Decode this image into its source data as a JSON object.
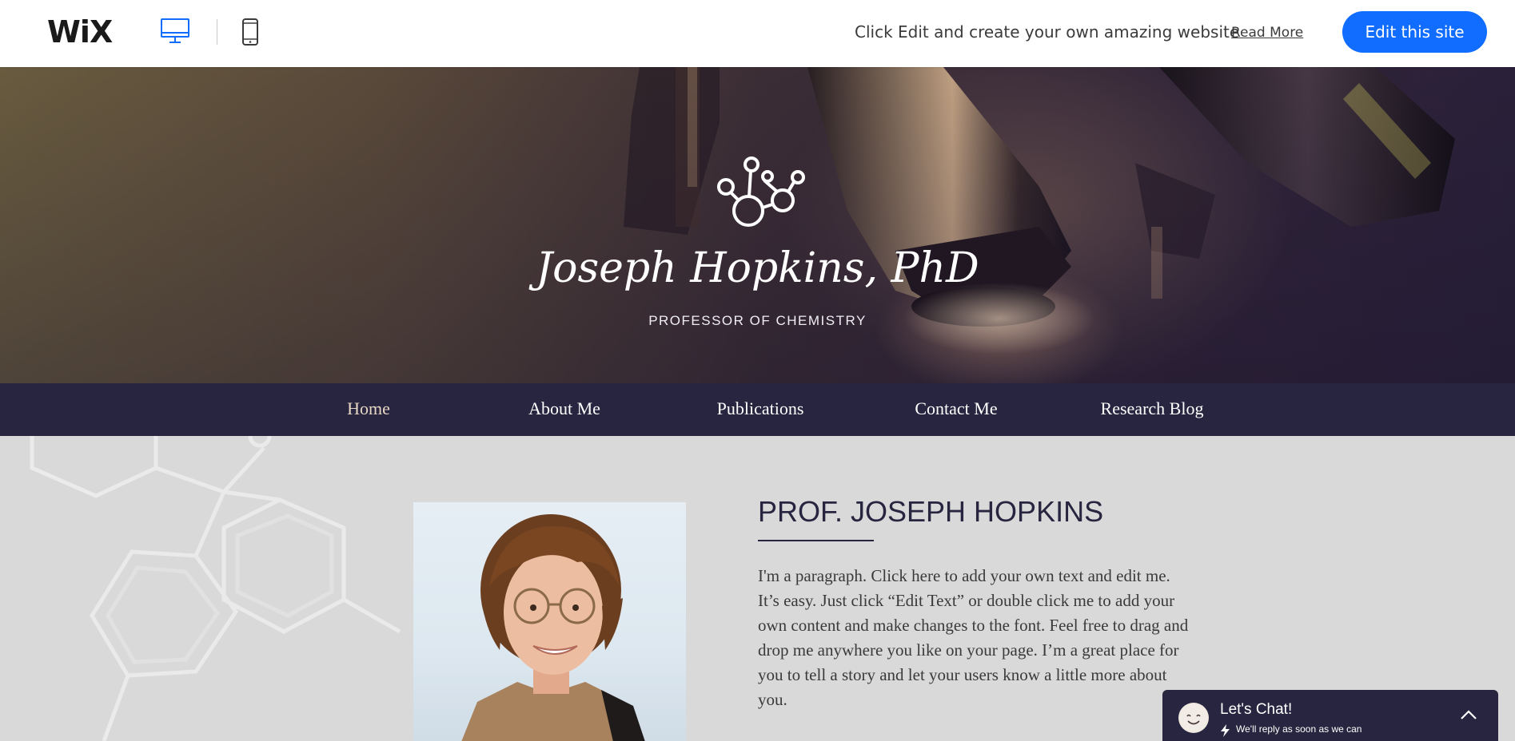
{
  "wixbar": {
    "logo": "WiX",
    "promo_text": "Click Edit and create your own amazing website",
    "read_more": "Read More",
    "edit_button": "Edit this site",
    "icons": [
      "desktop-icon",
      "mobile-icon"
    ],
    "accent_color": "#116dff"
  },
  "hero": {
    "title": "Joseph Hopkins, PhD",
    "subtitle": "PROFESSOR OF CHEMISTRY",
    "logo_icon": "molecule-icon"
  },
  "nav": {
    "items": [
      {
        "label": "Home",
        "active": true
      },
      {
        "label": "About Me",
        "active": false
      },
      {
        "label": "Publications",
        "active": false
      },
      {
        "label": "Contact Me",
        "active": false
      },
      {
        "label": "Research Blog",
        "active": false
      }
    ],
    "background": "#27253f"
  },
  "about": {
    "heading": "PROF. JOSEPH HOPKINS",
    "paragraph": "I'm a paragraph. Click here to add your own text and edit me. It’s easy. Just click “Edit Text” or double click me to add your own content and make changes to the font. Feel free to drag and drop me anywhere you like on your page. I’m a great place for you to tell a story and let your users know a little more about you."
  },
  "chat": {
    "title": "Let's Chat!",
    "subtitle": "We'll reply as soon as we can",
    "icons": [
      "smiley-avatar-icon",
      "lightning-icon",
      "chevron-up-icon"
    ]
  }
}
